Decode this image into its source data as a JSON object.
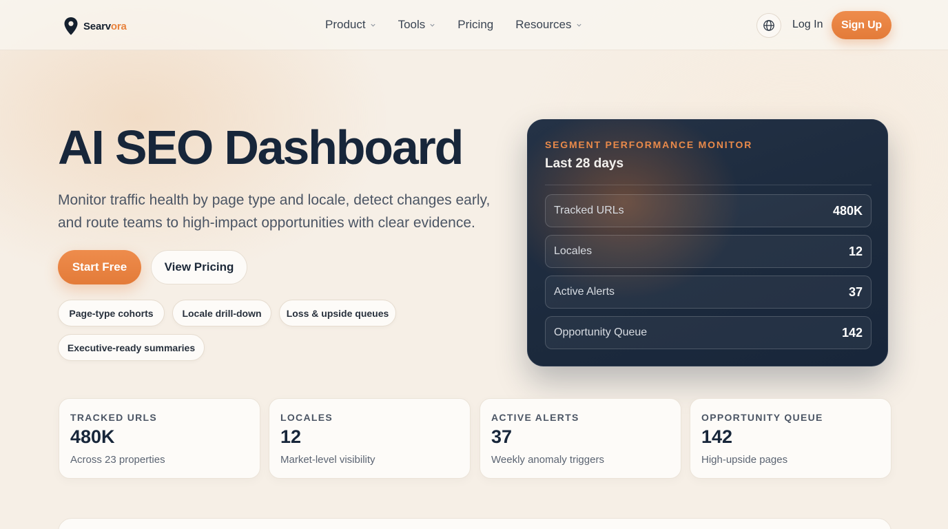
{
  "brand": {
    "name_main": "Searv",
    "name_accent": "ora",
    "accent_color": "#e8833e"
  },
  "nav": {
    "items": [
      {
        "label": "Product",
        "has_dropdown": true
      },
      {
        "label": "Tools",
        "has_dropdown": true
      },
      {
        "label": "Pricing",
        "has_dropdown": false
      },
      {
        "label": "Resources",
        "has_dropdown": true
      }
    ],
    "language_icon": "globe-icon",
    "login_label": "Log In",
    "signup_label": "Sign Up"
  },
  "hero": {
    "title": "AI SEO Dashboard",
    "subtitle": "Monitor traffic health by page type and locale, detect changes early, and route teams to high-impact opportunities with clear evidence.",
    "primary_cta": "Start Free",
    "secondary_cta": "View Pricing",
    "chips": [
      "Page-type cohorts",
      "Locale drill-down",
      "Loss & upside queues",
      "Executive-ready summaries"
    ]
  },
  "monitor": {
    "eyebrow": "SEGMENT PERFORMANCE MONITOR",
    "period": "Last 28 days",
    "rows": [
      {
        "label": "Tracked URLs",
        "value": "480K"
      },
      {
        "label": "Locales",
        "value": "12"
      },
      {
        "label": "Active Alerts",
        "value": "37"
      },
      {
        "label": "Opportunity Queue",
        "value": "142"
      }
    ]
  },
  "stats": [
    {
      "label": "TRACKED URLS",
      "value": "480K",
      "note": "Across 23 properties"
    },
    {
      "label": "LOCALES",
      "value": "12",
      "note": "Market-level visibility"
    },
    {
      "label": "ACTIVE ALERTS",
      "value": "37",
      "note": "Weekly anomaly triggers"
    },
    {
      "label": "OPPORTUNITY QUEUE",
      "value": "142",
      "note": "High-upside pages"
    }
  ],
  "colors": {
    "primary": "#e37b39",
    "ink": "#17263a",
    "panel_dark": "#1c2a3d",
    "background": "#f6efe6"
  }
}
